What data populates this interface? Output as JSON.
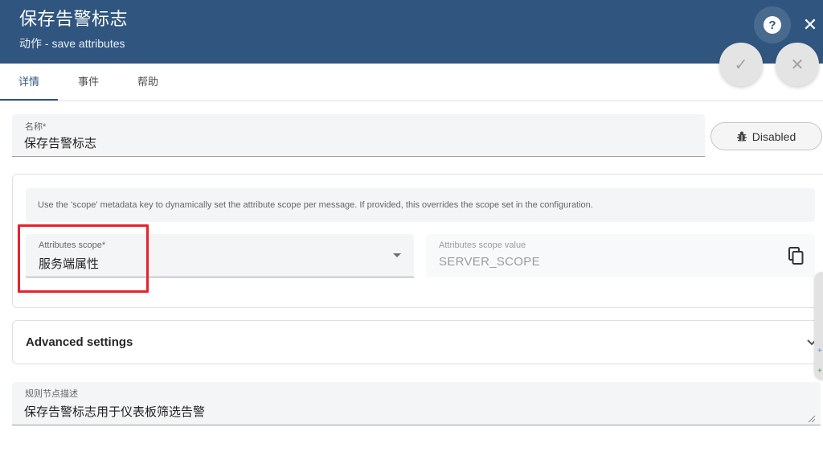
{
  "header": {
    "title": "保存告警标志",
    "subtitle": "动作 - save attributes",
    "help_icon": "help-circle-icon",
    "close_icon": "close-icon",
    "help_glyph": "?",
    "close_glyph": "✕"
  },
  "actions": {
    "apply_glyph": "✓",
    "cancel_glyph": "✕"
  },
  "tabs": [
    {
      "label": "详情",
      "active": true
    },
    {
      "label": "事件",
      "active": false
    },
    {
      "label": "帮助",
      "active": false
    }
  ],
  "name_field": {
    "label": "名称*",
    "value": "保存告警标志"
  },
  "debug_button": {
    "label": "Disabled",
    "icon": "bug-icon"
  },
  "config": {
    "hint": "Use the 'scope' metadata key to dynamically set the attribute scope per message. If provided, this overrides the scope set in the configuration.",
    "scope_label": "Attributes scope*",
    "scope_value": "服务端属性",
    "scope_value_label": "Attributes scope value",
    "scope_value_text": "SERVER_SCOPE"
  },
  "advanced": {
    "title": "Advanced settings"
  },
  "description": {
    "label": "规则节点描述",
    "value": "保存告警标志用于仪表板筛选告警"
  },
  "side_widget": {
    "dot1": "+",
    "dot2": "+"
  },
  "colors": {
    "header_bg": "#305680",
    "highlight": "#e8212b"
  }
}
